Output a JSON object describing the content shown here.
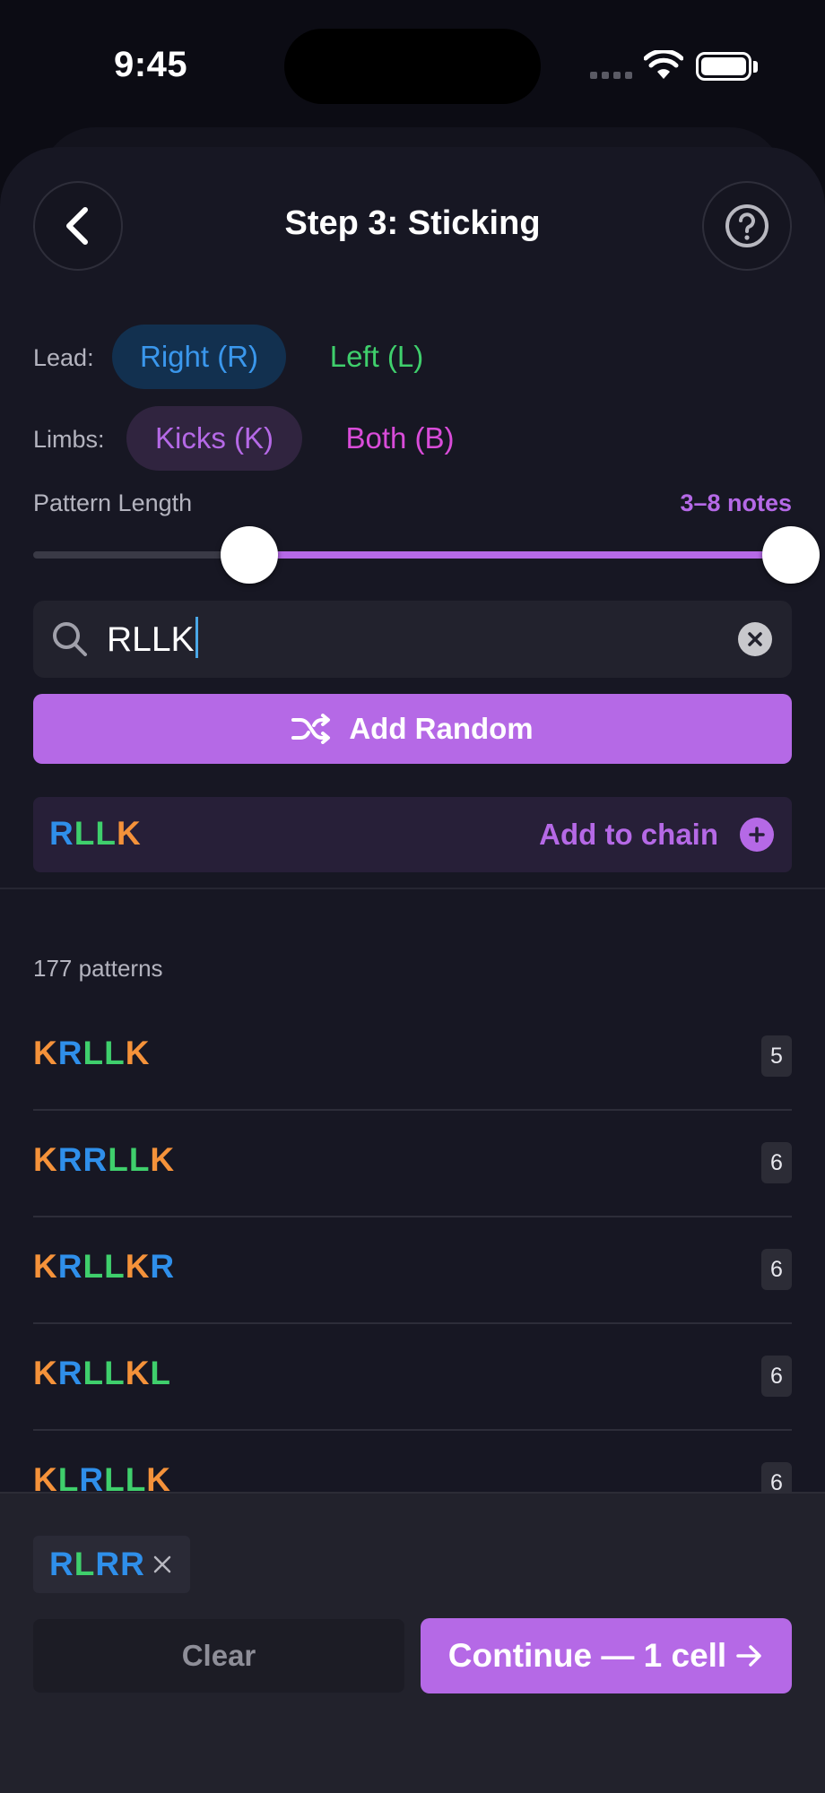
{
  "status_bar": {
    "time": "9:45"
  },
  "header": {
    "title": "Step 3: Sticking",
    "back_icon": "chevron-left-icon",
    "help_icon": "question-circle-icon"
  },
  "lead": {
    "label": "Lead:",
    "options": [
      {
        "label": "Right (R)",
        "selected": true
      },
      {
        "label": "Left (L)",
        "selected": false
      }
    ]
  },
  "limbs": {
    "label": "Limbs:",
    "options": [
      {
        "label": "Kicks (K)",
        "selected": true
      },
      {
        "label": "Both (B)",
        "selected": false
      }
    ]
  },
  "pattern_length": {
    "label": "Pattern Length",
    "value_text": "3–8 notes",
    "min": 3,
    "max": 8
  },
  "search": {
    "value": "RLLK"
  },
  "add_random": {
    "label": "Add Random"
  },
  "preview": {
    "pattern": "RLLK",
    "action_label": "Add to chain"
  },
  "results": {
    "count_label": "177 patterns",
    "items": [
      {
        "pattern": "KRLLK",
        "length": "5"
      },
      {
        "pattern": "KRRLLK",
        "length": "6"
      },
      {
        "pattern": "KRLLKR",
        "length": "6"
      },
      {
        "pattern": "KRLLKL",
        "length": "6"
      },
      {
        "pattern": "KLRLLK",
        "length": "6"
      }
    ]
  },
  "chain": {
    "items": [
      {
        "pattern": "RLRR"
      }
    ]
  },
  "footer": {
    "clear_label": "Clear",
    "continue_label": "Continue — 1 cell"
  },
  "colors": {
    "accent": "#b569e6",
    "right": "#2f8fea",
    "left": "#3fcf6c",
    "kick": "#f5923a",
    "both": "#d94cd9"
  }
}
